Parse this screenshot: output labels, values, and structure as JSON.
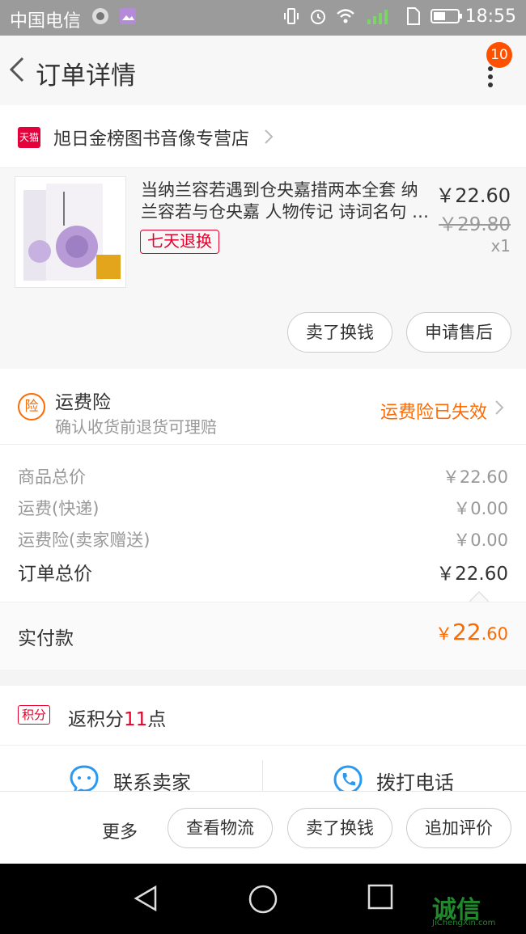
{
  "status_bar": {
    "carrier": "中国电信",
    "time": "18:55"
  },
  "header": {
    "title": "订单详情",
    "badge_count": "10"
  },
  "store": {
    "badge": "天猫",
    "name": "旭日金榜图书音像专营店"
  },
  "product": {
    "name": "当纳兰容若遇到仓央嘉措两本全套 纳兰容若与仓央嘉 人物传记 诗词名句 …",
    "tag": "七天退换",
    "price": "￥22.60",
    "original_price": "￥29.80",
    "quantity": "x1",
    "buttons": [
      "卖了换钱",
      "申请售后"
    ]
  },
  "insurance": {
    "icon_char": "险",
    "title": "运费险",
    "subtitle": "确认收货前退货可理赔",
    "status": "运费险已失效"
  },
  "summary": {
    "rows": [
      {
        "label": "商品总价",
        "value": "￥22.60"
      },
      {
        "label": "运费(快递)",
        "value": "￥0.00"
      },
      {
        "label": "运费险(卖家赠送)",
        "value": "￥0.00"
      }
    ],
    "total_label": "订单总价",
    "total_value": "￥22.60"
  },
  "paid": {
    "label": "实付款",
    "currency": "￥",
    "integer": "22",
    "decimal": ".60"
  },
  "points": {
    "tag": "积分",
    "text_prefix": "返积分",
    "number": "11",
    "text_suffix": "点"
  },
  "contact": {
    "seller_label": "联系卖家",
    "phone_label": "拨打电话"
  },
  "bottom_bar": {
    "more_label": "更多",
    "buttons": [
      "查看物流",
      "卖了换钱",
      "追加评价"
    ]
  },
  "watermark": {
    "main": "诚信",
    "sub": "JiChengXin.com"
  },
  "colors": {
    "accent": "#ff6a00",
    "tmall_red": "#e4002b",
    "badge": "#ff5000"
  }
}
